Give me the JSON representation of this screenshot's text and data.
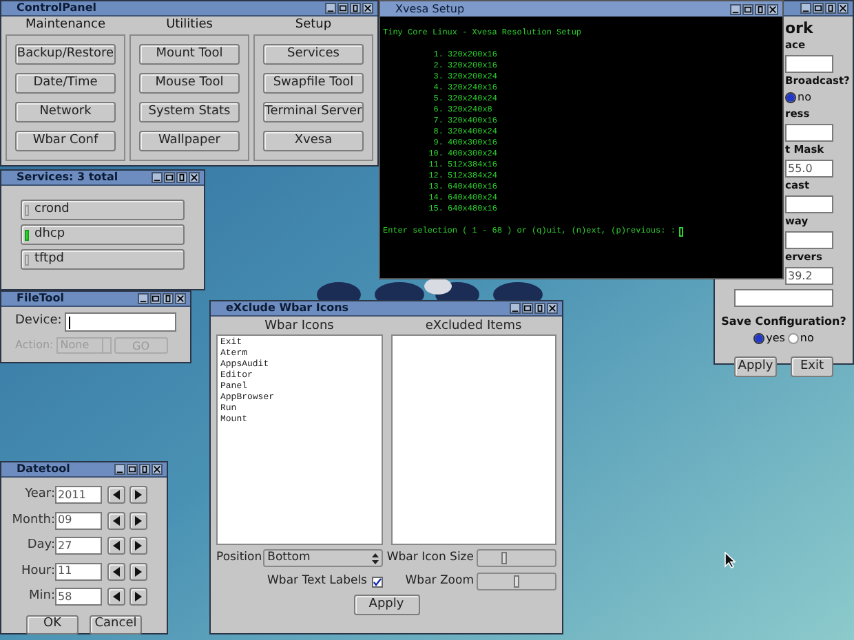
{
  "control_panel": {
    "title": "ControlPanel",
    "groups": [
      {
        "heading": "Maintenance",
        "buttons": [
          "Backup/Restore",
          "Date/Time",
          "Network",
          "Wbar Conf"
        ]
      },
      {
        "heading": "Utilities",
        "buttons": [
          "Mount Tool",
          "Mouse Tool",
          "System Stats",
          "Wallpaper"
        ]
      },
      {
        "heading": "Setup",
        "buttons": [
          "Services",
          "Swapfile Tool",
          "Terminal Server",
          "Xvesa"
        ]
      }
    ]
  },
  "services": {
    "title": "Services: 3 total",
    "items": [
      {
        "label": "crond",
        "on": false
      },
      {
        "label": "dhcp",
        "on": true
      },
      {
        "label": "tftpd",
        "on": false
      }
    ]
  },
  "file_tool": {
    "title": "FileTool",
    "device_label": "Device:",
    "action_label": "Action:",
    "action_value": "None",
    "go_button": "GO",
    "action_disabled": true
  },
  "xvesa": {
    "title": "Xvesa Setup",
    "heading": "Tiny Core Linux - Xvesa Resolution Setup",
    "options": [
      {
        "number": "1.",
        "mode": "320x200x16"
      },
      {
        "number": "2.",
        "mode": "320x200x16"
      },
      {
        "number": "3.",
        "mode": "320x200x24"
      },
      {
        "number": "4.",
        "mode": "320x240x16"
      },
      {
        "number": "5.",
        "mode": "320x240x24"
      },
      {
        "number": "6.",
        "mode": "320x240x8"
      },
      {
        "number": "7.",
        "mode": "320x400x16"
      },
      {
        "number": "8.",
        "mode": "320x400x24"
      },
      {
        "number": "9.",
        "mode": "400x300x16"
      },
      {
        "number": "10.",
        "mode": "400x300x24"
      },
      {
        "number": "11.",
        "mode": "512x384x16"
      },
      {
        "number": "12.",
        "mode": "512x384x24"
      },
      {
        "number": "13.",
        "mode": "640x400x16"
      },
      {
        "number": "14.",
        "mode": "640x400x24"
      },
      {
        "number": "15.",
        "mode": "640x480x16"
      }
    ],
    "prompt": "Enter selection ( 1 - 68 ) or (q)uit, (n)ext, (p)revious: :"
  },
  "network": {
    "heading": "ork",
    "rows": [
      {
        "kind": "label",
        "text": "ace"
      },
      {
        "kind": "field"
      },
      {
        "kind": "label",
        "text": "Broadcast?"
      },
      {
        "kind": "radio",
        "label": "no",
        "selected": true
      },
      {
        "kind": "label",
        "text": "ress"
      },
      {
        "kind": "field"
      },
      {
        "kind": "label",
        "text": "t Mask"
      },
      {
        "kind": "field",
        "value": "55.0"
      },
      {
        "kind": "label",
        "text": "cast"
      },
      {
        "kind": "field"
      },
      {
        "kind": "label",
        "text": "way"
      },
      {
        "kind": "field"
      },
      {
        "kind": "label",
        "text": "ervers"
      },
      {
        "kind": "field",
        "value": "39.2"
      }
    ],
    "save_label": "Save Configuration?",
    "save_options": [
      {
        "label": "yes",
        "selected": true
      },
      {
        "label": "no",
        "selected": false
      }
    ],
    "buttons": [
      "Apply",
      "Exit"
    ]
  },
  "wbar": {
    "title": "eXclude Wbar Icons",
    "left_heading": "Wbar Icons",
    "right_heading": "eXcluded Items",
    "icons": [
      "Exit",
      "Aterm",
      "AppsAudit",
      "Editor",
      "Panel",
      "AppBrowser",
      "Run",
      "Mount"
    ],
    "position_label": "Position",
    "position_value": "Bottom",
    "icon_size_label": "Wbar Icon Size",
    "icon_size": {
      "level": 0.33
    },
    "text_labels_label": "Wbar Text Labels",
    "text_labels_checked": true,
    "zoom_label": "Wbar Zoom",
    "zoom": {
      "level": 0.5
    },
    "apply": "Apply"
  },
  "datetool": {
    "title": "Datetool",
    "rows": [
      {
        "label": "Year:",
        "value": "2011"
      },
      {
        "label": "Month:",
        "value": "09"
      },
      {
        "label": "Day:",
        "value": "27"
      },
      {
        "label": "Hour:",
        "value": "11"
      },
      {
        "label": "Min:",
        "value": "58"
      }
    ],
    "buttons": [
      "OK",
      "Cancel"
    ]
  }
}
